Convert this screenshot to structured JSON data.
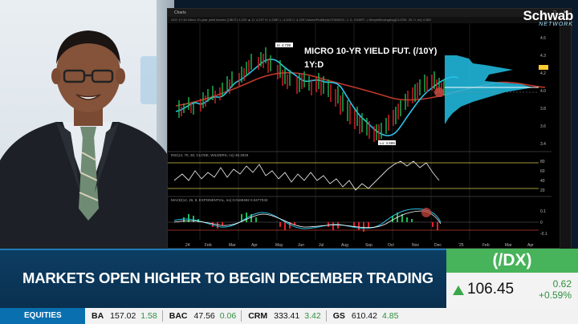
{
  "chart_window": {
    "title": "Charts",
    "toolbar_text": "/10Y 1Y:1D   Micro 10-year yield futures (CBOT)  4.229  ▲  O: 4.237  H: 4.2387  L: 4.209  C: 4.229   VolumeProfile(AUTOMATIC, 1, 0, CHART...)   SimpleMovingAvg(CLOSE, 20, 0, no)  4.369",
    "annotation": "MICRO 10-YR YIELD FUT. (/10Y)",
    "timeframe": "1Y:D",
    "high_label": "H: 4.739",
    "low_label": "Lo: 3.599",
    "rsi_label": "RSI(14, 70, 30, CLOSE, WILDERS, no) 45.2818",
    "macd_label": "MACD(12, 26, 9, EXPONENTIAL, no) 0.0160492  0.0477033",
    "x_axis_labels": [
      "24",
      "Feb",
      "Mar",
      "Apr",
      "May",
      "Jun",
      "Jul",
      "Aug",
      "Sep",
      "Oct",
      "Nov",
      "Dec",
      "'25",
      "Feb",
      "Mar",
      "Apr"
    ],
    "price_axis_labels": [
      "4.5",
      "4.3",
      "4.2",
      "4.0",
      "3.8",
      "3.6",
      "3.4"
    ],
    "rsi_axis_labels": [
      "80",
      "60",
      "40",
      "20"
    ],
    "macd_axis_labels": [
      "0.1",
      "0",
      "-0.1"
    ]
  },
  "logo": {
    "name": "Schwab",
    "network": "NETWORK"
  },
  "headline": "MARKETS OPEN HIGHER TO BEGIN DECEMBER TRADING",
  "quote": {
    "symbol": "(/DX)",
    "price": "106.45",
    "change": "0.62",
    "change_pct": "+0.59%",
    "direction": "up"
  },
  "ticker": {
    "category": "EQUITIES",
    "items": [
      {
        "symbol": "BA",
        "price": "157.02",
        "change": "1.58"
      },
      {
        "symbol": "BAC",
        "price": "47.56",
        "change": "0.06"
      },
      {
        "symbol": "CRM",
        "price": "333.41",
        "change": "3.42"
      },
      {
        "symbol": "GS",
        "price": "610.42",
        "change": "4.85"
      }
    ]
  },
  "colors": {
    "accent_green": "#47b35a",
    "up_green": "#2f8f3e",
    "lower_third_blue": "#0c3e63",
    "ticker_blue": "#0a6fae",
    "price_line_cyan": "#2ec3e6",
    "moving_avg_red": "#c0392b",
    "volume_profile": "#22c1e6"
  }
}
